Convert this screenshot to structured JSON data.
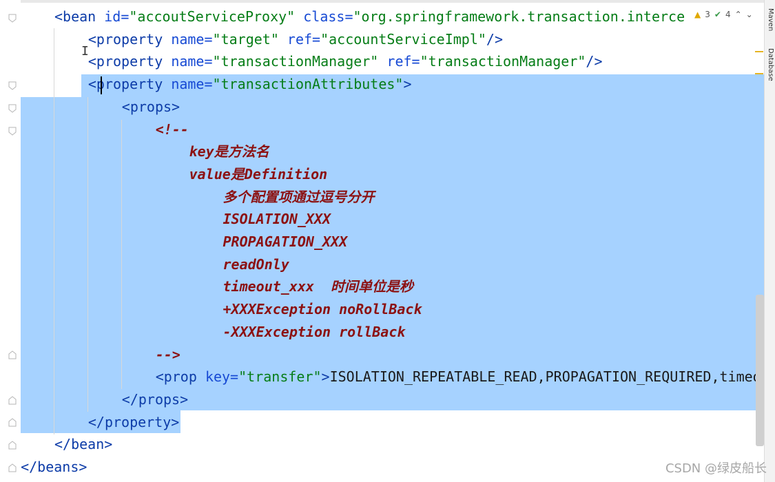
{
  "code_lines": [
    {
      "indent": 0,
      "tokens": [
        [
          "tag",
          "<bean "
        ],
        [
          "attr",
          "id="
        ],
        [
          "str",
          "\"accoutServiceProxy\""
        ],
        [
          "plain",
          " "
        ],
        [
          "attr",
          "class="
        ],
        [
          "str",
          "\"org.springframework.transaction.interce"
        ]
      ]
    },
    {
      "indent": 1,
      "tokens": [
        [
          "tag",
          "<property "
        ],
        [
          "attr",
          "name="
        ],
        [
          "str",
          "\"target\""
        ],
        [
          "plain",
          " "
        ],
        [
          "attr",
          "ref="
        ],
        [
          "str",
          "\"accountServiceImpl\""
        ],
        [
          "tag",
          "/>"
        ]
      ]
    },
    {
      "indent": 1,
      "tokens": [
        [
          "tag",
          "<property "
        ],
        [
          "attr",
          "name="
        ],
        [
          "str",
          "\"transactionManager\""
        ],
        [
          "plain",
          " "
        ],
        [
          "attr",
          "ref="
        ],
        [
          "str",
          "\"transactionManager\""
        ],
        [
          "tag",
          "/>"
        ]
      ]
    },
    {
      "indent": 1,
      "tokens": [
        [
          "tag",
          "<property "
        ],
        [
          "attr",
          "name="
        ],
        [
          "str",
          "\"transactionAttributes\""
        ],
        [
          "tag",
          ">"
        ]
      ]
    },
    {
      "indent": 2,
      "tokens": [
        [
          "tag",
          "<props>"
        ]
      ]
    },
    {
      "indent": 3,
      "tokens": [
        [
          "cmt",
          "<!--"
        ]
      ]
    },
    {
      "indent": 4,
      "tokens": [
        [
          "cmt",
          "key是方法名"
        ]
      ]
    },
    {
      "indent": 4,
      "tokens": [
        [
          "cmt",
          "value是Definition"
        ]
      ]
    },
    {
      "indent": 5,
      "tokens": [
        [
          "cmt",
          "多个配置项通过逗号分开"
        ]
      ]
    },
    {
      "indent": 5,
      "tokens": [
        [
          "cmt",
          "ISOLATION_XXX"
        ]
      ]
    },
    {
      "indent": 5,
      "tokens": [
        [
          "cmt",
          "PROPAGATION_XXX"
        ]
      ]
    },
    {
      "indent": 5,
      "tokens": [
        [
          "cmt",
          "readOnly"
        ]
      ]
    },
    {
      "indent": 5,
      "tokens": [
        [
          "cmt",
          "timeout_xxx  时间单位是秒"
        ]
      ]
    },
    {
      "indent": 5,
      "tokens": [
        [
          "cmt",
          "+XXXException noRollBack"
        ]
      ]
    },
    {
      "indent": 5,
      "tokens": [
        [
          "cmt",
          "-XXXException rollBack"
        ]
      ]
    },
    {
      "indent": 3,
      "tokens": [
        [
          "cmt",
          "-->"
        ]
      ]
    },
    {
      "indent": 3,
      "tokens": [
        [
          "tag",
          "<prop "
        ],
        [
          "attr",
          "key="
        ],
        [
          "str",
          "\"transfer\""
        ],
        [
          "tag",
          ">"
        ],
        [
          "plain",
          "ISOLATION_REPEATABLE_READ,PROPAGATION_REQUIRED,timeo"
        ]
      ]
    },
    {
      "indent": 2,
      "tokens": [
        [
          "tag",
          "</props>"
        ]
      ]
    },
    {
      "indent": 1,
      "tokens": [
        [
          "tag",
          "</property>"
        ]
      ]
    },
    {
      "indent": 0,
      "tokens": [
        [
          "tag",
          "</bean>"
        ]
      ]
    },
    {
      "indent": -1,
      "tokens": [
        [
          "tag",
          "</beans>"
        ]
      ]
    }
  ],
  "inspections": {
    "warnings": "3",
    "weak_warnings": "4"
  },
  "side_tabs": [
    "Maven",
    "Database"
  ],
  "watermark": "CSDN @绿皮船长",
  "colors": {
    "selection": "#a6d2ff",
    "tag": "#0d3ca8",
    "string": "#067d17",
    "comment": "#8c1212"
  }
}
